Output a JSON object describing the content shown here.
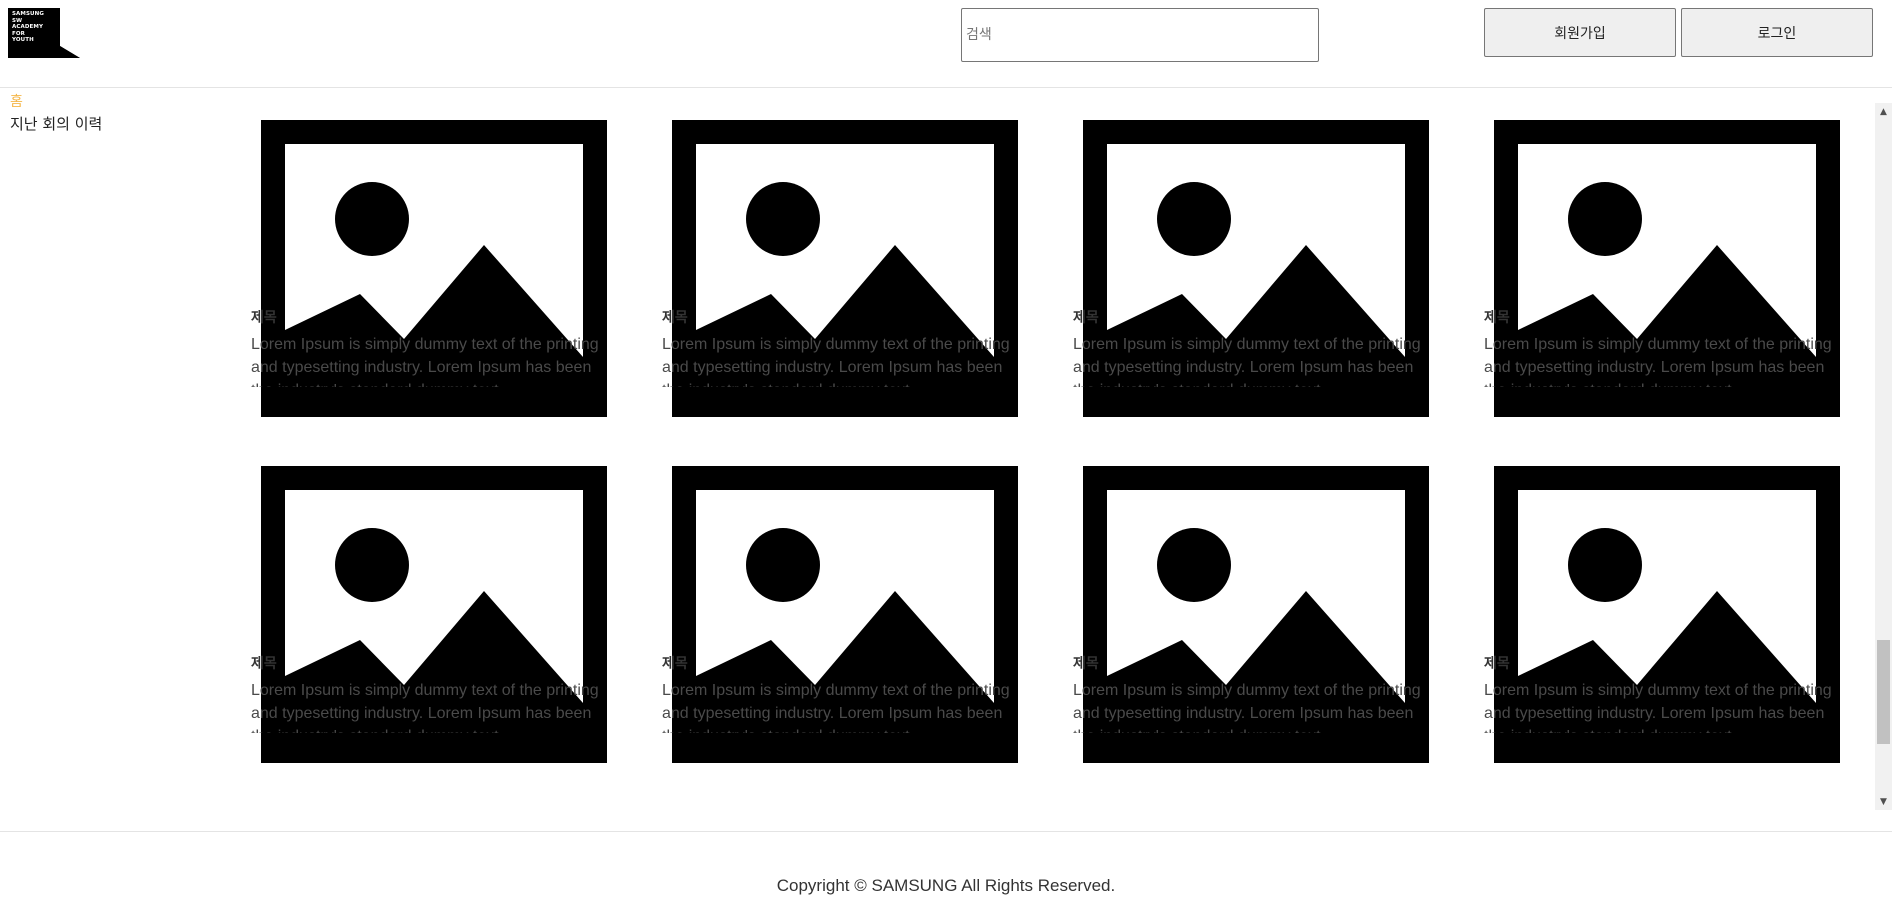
{
  "header": {
    "logo_lines": [
      "SAMSUNG",
      "SW",
      "ACADEMY",
      "FOR",
      "YOUTH"
    ],
    "search_placeholder": "검색",
    "signup_label": "회원가입",
    "login_label": "로그인"
  },
  "sidebar": {
    "home_label": "홈",
    "history_label": "지난 회의 이력"
  },
  "cards": [
    {
      "title": "제목",
      "description": "Lorem Ipsum is simply dummy text of the printing and typesetting industry. Lorem Ipsum has been the industry's standard dummy text"
    },
    {
      "title": "제목",
      "description": "Lorem Ipsum is simply dummy text of the printing and typesetting industry. Lorem Ipsum has been the industry's standard dummy text"
    },
    {
      "title": "제목",
      "description": "Lorem Ipsum is simply dummy text of the printing and typesetting industry. Lorem Ipsum has been the industry's standard dummy text"
    },
    {
      "title": "제목",
      "description": "Lorem Ipsum is simply dummy text of the printing and typesetting industry. Lorem Ipsum has been the industry's standard dummy text"
    },
    {
      "title": "제목",
      "description": "Lorem Ipsum is simply dummy text of the printing and typesetting industry. Lorem Ipsum has been the industry's standard dummy text"
    },
    {
      "title": "제목",
      "description": "Lorem Ipsum is simply dummy text of the printing and typesetting industry. Lorem Ipsum has been the industry's standard dummy text"
    },
    {
      "title": "제목",
      "description": "Lorem Ipsum is simply dummy text of the printing and typesetting industry. Lorem Ipsum has been the industry's standard dummy text"
    },
    {
      "title": "제목",
      "description": "Lorem Ipsum is simply dummy text of the printing and typesetting industry. Lorem Ipsum has been the industry's standard dummy text"
    }
  ],
  "icons": {
    "card_image": "image-placeholder-icon",
    "scroll_up": "arrow-up-icon",
    "scroll_down": "arrow-down-icon"
  },
  "colors": {
    "accent": "#f5b74a",
    "logo_background": "#000000"
  },
  "footer": {
    "copyright": "Copyright © SAMSUNG All Rights Reserved."
  }
}
